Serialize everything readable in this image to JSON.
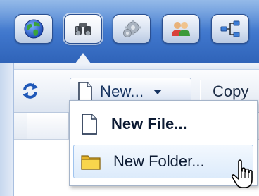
{
  "topbar": {
    "buttons": [
      {
        "icon": "globe-icon"
      },
      {
        "icon": "binoculars-icon",
        "active": true
      },
      {
        "icon": "gears-icon"
      },
      {
        "icon": "users-icon"
      },
      {
        "icon": "network-icon"
      }
    ],
    "accent_color": "#3f76cc"
  },
  "toolbar": {
    "refresh_icon": "refresh-icon",
    "new_label": "New...",
    "copy_label": "Copy"
  },
  "menu": {
    "items": [
      {
        "label": "New File...",
        "icon": "file-icon",
        "bold": true
      },
      {
        "label": "New Folder...",
        "icon": "folder-icon",
        "hovered": true
      }
    ]
  },
  "cursor": {
    "icon": "hand-pointer-icon"
  }
}
